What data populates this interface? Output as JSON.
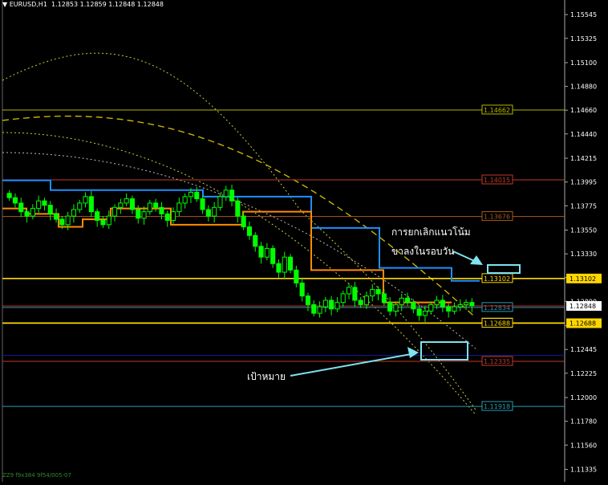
{
  "header": {
    "symbol_label": "EURUSD,H1",
    "ohlc": "1.12853 1.12859 1.12848 1.12848"
  },
  "footer": {
    "text": "ZZ9 f9x384 9f54/005-07"
  },
  "annotations": {
    "cancel_trend_line1": "การยกเลิกแนวโน้ม",
    "cancel_trend_line2": "ขาลงในรอบวัน",
    "target": "เป้าหมาย"
  },
  "colors": {
    "background": "#000000",
    "bull_candle": "#00ff00",
    "bear_candle": "#00ff00",
    "blue_line": "#1e90ff",
    "orange_line": "#ff8c00",
    "yellow_level": "#ffd700",
    "annotation": "#7fe3f0"
  },
  "chart_data": {
    "type": "candlestick",
    "ylim": [
      1.1122,
      1.1568
    ],
    "yticks": [
      "1.15545",
      "1.15325",
      "1.15100",
      "1.14880",
      "1.14660",
      "1.14440",
      "1.14215",
      "1.13995",
      "1.13775",
      "1.13550",
      "1.13330",
      "1.13110",
      "1.12890",
      "1.12665",
      "1.12445",
      "1.12225",
      "1.12000",
      "1.11780",
      "1.11560",
      "1.11335"
    ],
    "current_price": "1.12848",
    "horizontal_levels": [
      {
        "price": 1.14662,
        "label": "1.14662",
        "color": "#b5b500"
      },
      {
        "price": 1.14015,
        "label": "1.14015",
        "color": "#c23a2a"
      },
      {
        "price": 1.13676,
        "label": "1.13676",
        "color": "#a85a1e"
      },
      {
        "price": 1.13102,
        "label": "1.13102",
        "color": "#ffd700",
        "axis_label": true
      },
      {
        "price": 1.12834,
        "label": "1.12834",
        "color": "#2a9bb0"
      },
      {
        "price": 1.1269,
        "label": "1.12690",
        "color": "#ffd700"
      },
      {
        "price": 1.12688,
        "label": "1.12688",
        "color": "#ffd700",
        "axis_label": true
      },
      {
        "price": 1.1239,
        "label": "",
        "color": "#1a1aa0"
      },
      {
        "price": 1.12335,
        "label": "1.12335",
        "color": "#c23a2a"
      },
      {
        "price": 1.11918,
        "label": "1.11918",
        "color": "#2a9bb0"
      }
    ],
    "blue_line": [
      [
        0,
        1.1401
      ],
      [
        60,
        1.1401
      ],
      [
        60,
        1.1392
      ],
      [
        130,
        1.1392
      ],
      [
        130,
        1.1392
      ],
      [
        250,
        1.1392
      ],
      [
        250,
        1.1386
      ],
      [
        385,
        1.1386
      ],
      [
        385,
        1.1357
      ],
      [
        470,
        1.1357
      ],
      [
        470,
        1.132
      ],
      [
        560,
        1.132
      ],
      [
        560,
        1.1308
      ],
      [
        595,
        1.1308
      ]
    ],
    "orange_line": [
      [
        0,
        1.1375
      ],
      [
        30,
        1.1375
      ],
      [
        30,
        1.137
      ],
      [
        70,
        1.137
      ],
      [
        70,
        1.1358
      ],
      [
        100,
        1.1358
      ],
      [
        100,
        1.1365
      ],
      [
        135,
        1.1365
      ],
      [
        135,
        1.1375
      ],
      [
        210,
        1.1375
      ],
      [
        210,
        1.136
      ],
      [
        300,
        1.136
      ],
      [
        300,
        1.1372
      ],
      [
        385,
        1.1372
      ],
      [
        385,
        1.1318
      ],
      [
        475,
        1.1318
      ],
      [
        475,
        1.1288
      ],
      [
        560,
        1.1288
      ]
    ],
    "candles_close": [
      1.1385,
      1.138,
      1.1372,
      1.1368,
      1.1375,
      1.1382,
      1.1378,
      1.137,
      1.1365,
      1.136,
      1.1368,
      1.1374,
      1.138,
      1.1386,
      1.1372,
      1.1364,
      1.136,
      1.1368,
      1.1376,
      1.138,
      1.1384,
      1.1374,
      1.1366,
      1.1372,
      1.138,
      1.1376,
      1.137,
      1.1364,
      1.1372,
      1.138,
      1.1386,
      1.139,
      1.1384,
      1.1374,
      1.1368,
      1.1376,
      1.1386,
      1.1392,
      1.1382,
      1.1368,
      1.1358,
      1.135,
      1.134,
      1.133,
      1.1338,
      1.1324,
      1.1316,
      1.133,
      1.1318,
      1.1306,
      1.1294,
      1.1286,
      1.1278,
      1.1284,
      1.129,
      1.1282,
      1.1288,
      1.1296,
      1.1302,
      1.129,
      1.1286,
      1.1294,
      1.13,
      1.1296,
      1.1288,
      1.128,
      1.1286,
      1.1292,
      1.1288,
      1.1282,
      1.1276,
      1.128,
      1.1286,
      1.129,
      1.1284,
      1.128,
      1.1284,
      1.1286,
      1.1288,
      1.1285
    ]
  }
}
